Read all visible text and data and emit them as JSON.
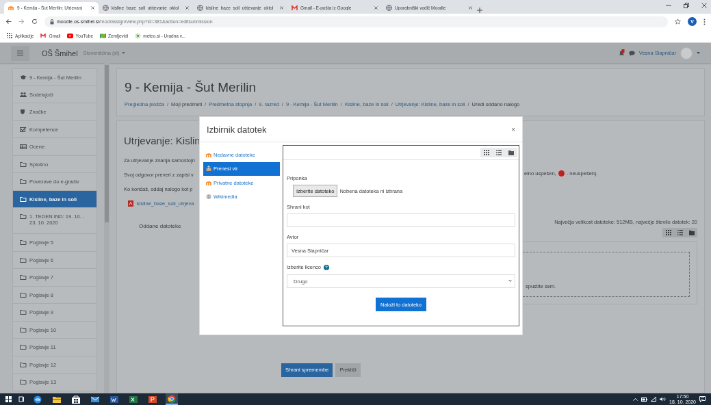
{
  "browser": {
    "tabs": [
      {
        "title": "9 - Kemija - Šut Merilin: Utrjevanj",
        "kind": "moodle",
        "selected": true
      },
      {
        "title": "kisline_baze_soli_utrjevanje_oktol",
        "kind": "globe",
        "selected": false
      },
      {
        "title": "kisline_baze_soli_utrjevanje_oktol",
        "kind": "globe",
        "selected": false
      },
      {
        "title": "Gmail - E-pošta iz Google",
        "kind": "gmail",
        "selected": false
      },
      {
        "title": "Uporabniški vodič Moodle",
        "kind": "globe",
        "selected": false
      }
    ],
    "address": {
      "host": "moodle.os-smihel.si",
      "path": "/mod/assign/view.php?id=381&action=editsubmission"
    },
    "profile_initial": "V",
    "bookmarks": [
      {
        "label": "Aplikacije",
        "kind": "apps"
      },
      {
        "label": "Gmail",
        "kind": "gmail"
      },
      {
        "label": "YouTube",
        "kind": "youtube"
      },
      {
        "label": "Zemljevidi",
        "kind": "maps"
      },
      {
        "label": "meteo.si - Uradna v...",
        "kind": "meteo"
      }
    ]
  },
  "navbar": {
    "site_name": "OŠ Šmihel",
    "language": "Slovenščina (sl)",
    "user_name": "Vesna Slapničar"
  },
  "sidebar": {
    "items": [
      {
        "label": "9 - Kemija - Šut Merilin",
        "kind": "course",
        "selected": false
      },
      {
        "label": "Sodelujoči",
        "kind": "users",
        "selected": false
      },
      {
        "label": "Značke",
        "kind": "shield",
        "selected": false
      },
      {
        "label": "Kompetence",
        "kind": "check",
        "selected": false
      },
      {
        "label": "Ocene",
        "kind": "table",
        "selected": false
      },
      {
        "label": "Splošno",
        "kind": "folder",
        "selected": false
      },
      {
        "label": "Povezave do e-gradiv",
        "kind": "folder",
        "selected": false
      },
      {
        "label": "Kisline, baze in soli",
        "kind": "folder",
        "selected": true
      },
      {
        "label": "1. TEDEN IND: 19. 10. - 23. 10. 2020",
        "kind": "folder",
        "selected": false
      },
      {
        "label": "Poglavje 5",
        "kind": "folder",
        "selected": false
      },
      {
        "label": "Poglavje 6",
        "kind": "folder",
        "selected": false
      },
      {
        "label": "Poglavje 7",
        "kind": "folder",
        "selected": false
      },
      {
        "label": "Poglavje 8",
        "kind": "folder",
        "selected": false
      },
      {
        "label": "Poglavje 9",
        "kind": "folder",
        "selected": false
      },
      {
        "label": "Poglavje 10",
        "kind": "folder",
        "selected": false
      },
      {
        "label": "Poglavje 11",
        "kind": "folder",
        "selected": false
      },
      {
        "label": "Poglavje 12",
        "kind": "folder",
        "selected": false
      },
      {
        "label": "Poglavje 13",
        "kind": "folder",
        "selected": false
      }
    ]
  },
  "page": {
    "title": "9 - Kemija - Šut Merilin",
    "breadcrumb_separator": "/",
    "breadcrumb": [
      {
        "label": "Pregledna plošča",
        "link": true
      },
      {
        "label": "Moji predmeti",
        "link": false
      },
      {
        "label": "Predmetna stopnja",
        "link": true
      },
      {
        "label": "9. razred",
        "link": true
      },
      {
        "label": "9 - Kemija - Šut Merilin",
        "link": true
      },
      {
        "label": "Kisline, baze in soli",
        "link": true
      },
      {
        "label": "Utrjevanje: Kisline, baze in soli",
        "link": true
      },
      {
        "label": "Uredi oddano nalogo",
        "link": false
      }
    ]
  },
  "assignment": {
    "title": "Utrjevanje: Kislin",
    "lines": [
      "Za utrjevanje znanja samostojn",
      "Svoj odgovor preveri z zapisi v",
      "Ko končaš, oddaj nalogo kot p"
    ],
    "file_link": "kisline_baze_soli_utrjeva",
    "submission_label": "Oddane datoteke",
    "legend": {
      "before": "elno uspešen,",
      "after": "- neuspešen).",
      "color": "#c0211f"
    },
    "max_size": "Največja velikost datoteke: 512MB, največje število datotek: 20",
    "drop_hint": "spustite sem.",
    "buttons": [
      {
        "label": "Shrani spremembe",
        "kind": "primary"
      },
      {
        "label": "Prekliči",
        "kind": "secondary"
      }
    ]
  },
  "modal": {
    "title": "Izbirnik datotek",
    "close": "×",
    "repositories": [
      {
        "label": "Nedavne datoteke",
        "kind": "moodle",
        "selected": false
      },
      {
        "label": "Prenesi vir",
        "kind": "upload",
        "selected": true
      },
      {
        "label": "Privatne datoteke",
        "kind": "moodle",
        "selected": false
      },
      {
        "label": "Wikimedia",
        "kind": "wiki",
        "selected": false
      }
    ],
    "attachment_label": "Priponka",
    "choose_button": "Izberite datoteko",
    "no_file": "Nobena datoteka ni izbrana",
    "save_as_label": "Shrani kot",
    "author_label": "Avtor",
    "author_value": "Vesna Slapničar",
    "license_label": "Izberite licenco",
    "license_value": "Drugo",
    "upload_button": "Naloži to datoteko"
  },
  "taskbar": {
    "apps": [
      {
        "kind": "edge",
        "selected": false
      },
      {
        "kind": "explorer",
        "selected": false
      },
      {
        "kind": "store",
        "selected": false
      },
      {
        "kind": "mail",
        "selected": false
      },
      {
        "kind": "word",
        "selected": false
      },
      {
        "kind": "excel",
        "selected": false
      },
      {
        "kind": "powerpoint",
        "selected": false
      },
      {
        "kind": "chrome",
        "selected": true
      }
    ],
    "time": "17:50",
    "date": "18. 10. 2020"
  }
}
